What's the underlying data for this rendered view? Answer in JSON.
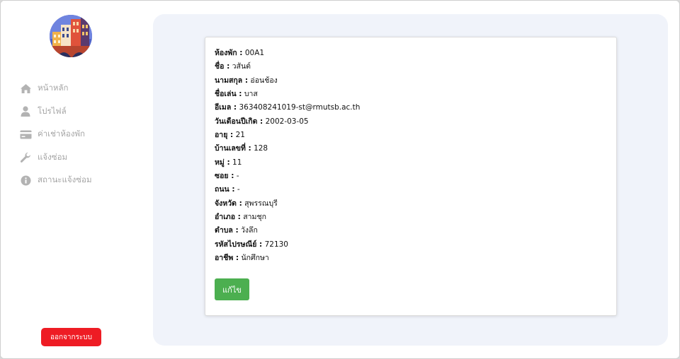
{
  "sidebar": {
    "items": [
      {
        "label": "หน้าหลัก",
        "icon": "home-icon"
      },
      {
        "label": "โปรไฟล์",
        "icon": "user-icon"
      },
      {
        "label": "ค่าเช่าห้องพัก",
        "icon": "credit-card-icon"
      },
      {
        "label": "แจ้งซ่อม",
        "icon": "wrench-icon"
      },
      {
        "label": "สถานะแจ้งซ่อม",
        "icon": "info-circle-icon"
      }
    ],
    "logout_label": "ออกจากระบบ"
  },
  "profile": {
    "fields": [
      {
        "label": "ห้องพัก :",
        "value": "00A1"
      },
      {
        "label": "ชื่อ :",
        "value": "วสันต์"
      },
      {
        "label": "นามสกุล :",
        "value": "อ่อนช้อง"
      },
      {
        "label": "ชื่อเล่น :",
        "value": "บาส"
      },
      {
        "label": "อีเมล :",
        "value": "363408241019-st@rmutsb.ac.th"
      },
      {
        "label": "วันเดือนปีเกิด :",
        "value": "2002-03-05"
      },
      {
        "label": "อายุ :",
        "value": "21"
      },
      {
        "label": "บ้านเลขที่ :",
        "value": "128"
      },
      {
        "label": "หมู่ :",
        "value": "11"
      },
      {
        "label": "ซอย :",
        "value": "-"
      },
      {
        "label": "ถนน :",
        "value": "-"
      },
      {
        "label": "จังหวัด :",
        "value": "สุพรรณบุรี"
      },
      {
        "label": "อำเภอ :",
        "value": "สามชุก"
      },
      {
        "label": "ตำบล :",
        "value": "วังลึก"
      },
      {
        "label": "รหัสไปรษณีย์ :",
        "value": "72130"
      },
      {
        "label": "อาชีพ :",
        "value": "นักศึกษา"
      }
    ],
    "edit_label": "แก้ไข"
  },
  "colors": {
    "logout": "#ee1c24",
    "edit": "#4caf50",
    "main_bg": "#f0f3fa",
    "nav_text": "#a5a5a5"
  }
}
